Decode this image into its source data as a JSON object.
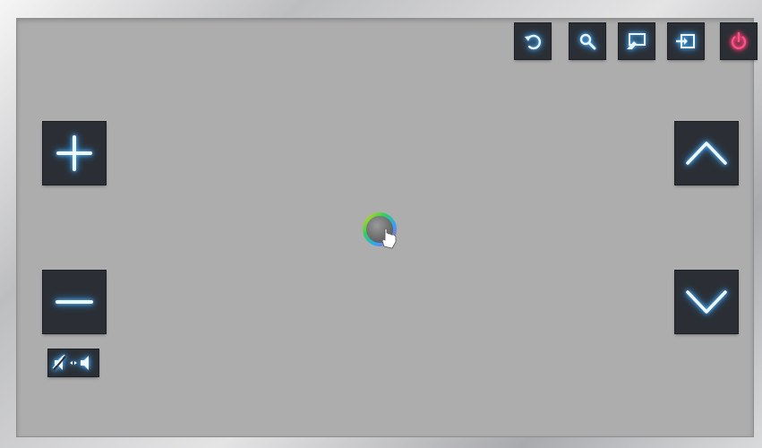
{
  "screen": {
    "top_bar": [
      {
        "name": "return",
        "icon": "return-icon"
      },
      {
        "name": "search",
        "icon": "search-icon"
      },
      {
        "name": "screen-share",
        "icon": "screen-share-icon"
      },
      {
        "name": "source",
        "icon": "source-input-icon"
      },
      {
        "name": "power",
        "icon": "power-icon"
      }
    ],
    "volume": {
      "up_icon": "plus-icon",
      "down_icon": "minus-icon",
      "mute_icon": "mute-toggle-icon"
    },
    "channel": {
      "up_icon": "chevron-up-icon",
      "down_icon": "chevron-down-icon"
    },
    "pointer": {
      "icon": "hand-pointer-icon"
    },
    "colors": {
      "glow": "#4aa8ff",
      "power": "#ff3d78",
      "button": "#2b2f35",
      "screen": "#adadad"
    }
  }
}
